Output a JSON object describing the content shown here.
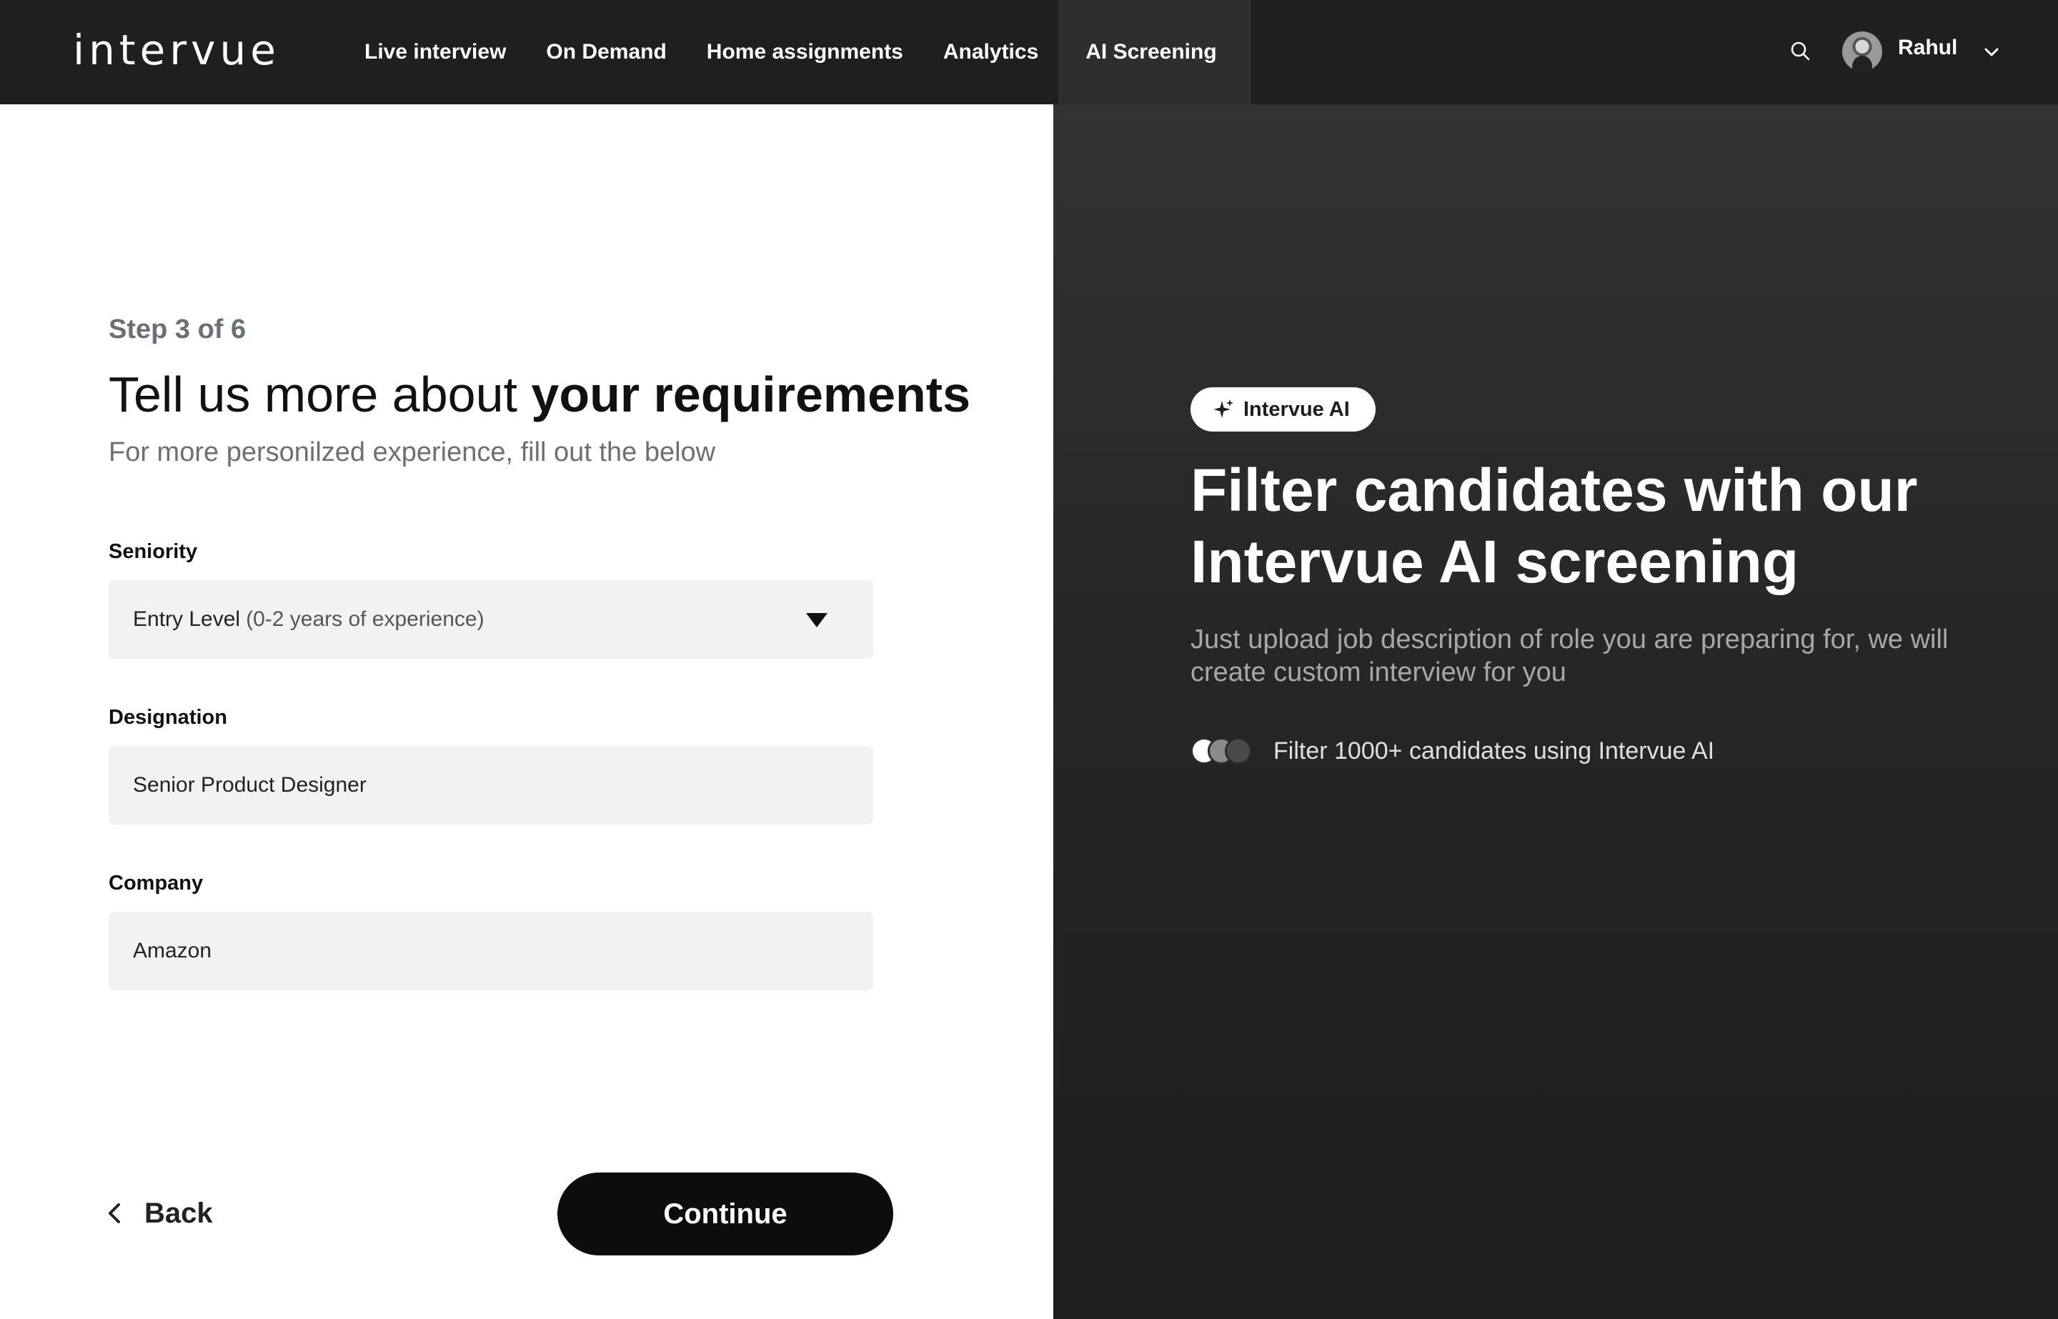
{
  "header": {
    "logo_text": "intervue",
    "nav": [
      {
        "label": "Live interview"
      },
      {
        "label": "On Demand"
      },
      {
        "label": "Home assignments"
      },
      {
        "label": "Analytics"
      },
      {
        "label": "AI Screening",
        "active": true
      }
    ],
    "user_name": "Rahul",
    "icons": {
      "search": "search-icon",
      "chevron": "chevron-down-icon"
    }
  },
  "form": {
    "step": "Step 3 of 6",
    "title_regular": "Tell us more about ",
    "title_bold": "your requirements",
    "subtitle": "For more personilzed experience, fill out the below",
    "seniority": {
      "label": "Seniority",
      "value": "Entry Level",
      "value_detail": "(0-2 years of experience)"
    },
    "designation": {
      "label": "Designation",
      "value": "Senior Product Designer"
    },
    "company": {
      "label": "Company",
      "value": "Amazon"
    },
    "back_label": "Back",
    "continue_label": "Continue"
  },
  "promo": {
    "badge": "Intervue AI",
    "title_line1": "Filter candidates with our",
    "title_line2": "Intervue AI screening",
    "description": "Just upload job description of role you are preparing for,  we will create custom interview for you",
    "stat": "Filter 1000+ candidates  using Intervue AI"
  },
  "colors": {
    "header_bg": "#1f1f1f",
    "active_tab_bg": "#2e2e2e",
    "field_bg": "#f2f2f2",
    "primary_button": "#0d0d0d",
    "muted_text": "#6b6f76"
  }
}
